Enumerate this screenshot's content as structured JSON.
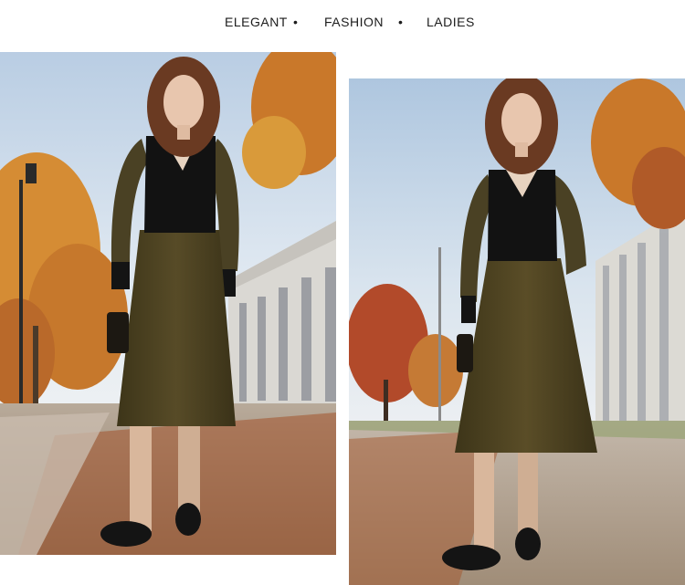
{
  "header": {
    "words": [
      "ELEGANT",
      "FASHION",
      "LADIES"
    ],
    "separator": "•"
  },
  "photos": [
    {
      "name": "left-photo"
    },
    {
      "name": "right-photo"
    }
  ],
  "colors": {
    "dress_olive": "#4c4323",
    "top_black": "#111111",
    "foliage_orange": "#c9782a",
    "sky_blue": "#c7d7e8"
  }
}
